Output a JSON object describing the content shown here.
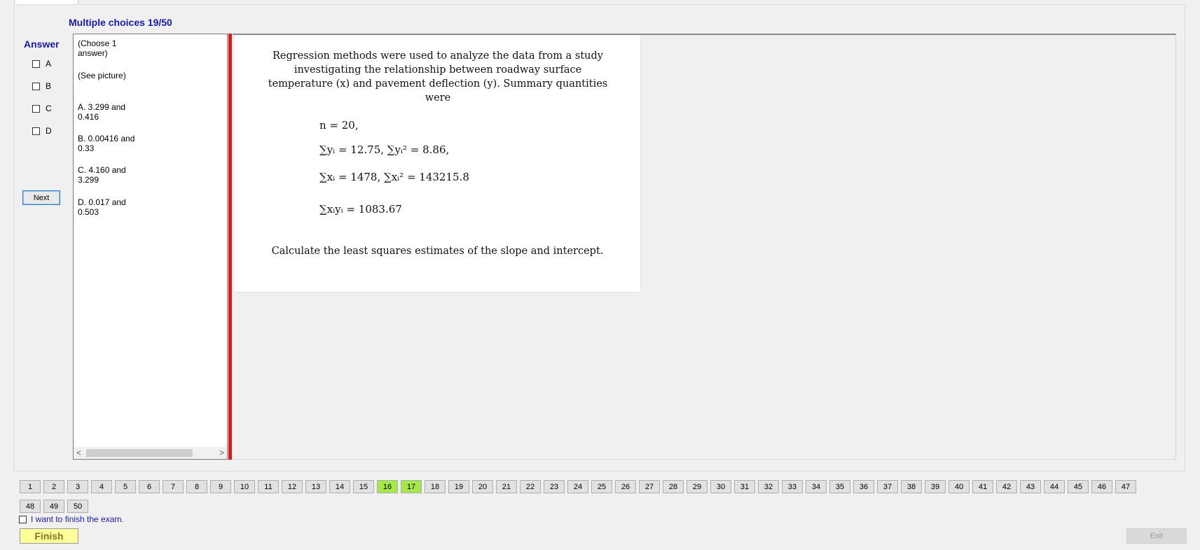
{
  "header": {
    "question_title": "Multiple choices 19/50"
  },
  "answer_panel": {
    "title": "Answer",
    "options": [
      "A",
      "B",
      "C",
      "D"
    ],
    "next_label": "Next"
  },
  "choices_text": {
    "instruction": "(Choose 1\nanswer)",
    "see_picture": "(See picture)",
    "items": [
      "A.  3.299 and\n0.416",
      "B.  0.00416 and\n0.33",
      "C.  4.160 and\n3.299",
      "D.  0.017 and\n0.503"
    ]
  },
  "picture": {
    "paragraph": "Regression methods were used to analyze the data from a study investigating the relationship between roadway surface temperature (x) and pavement deflection (y). Summary quantities were",
    "eq_n": "n = 20,",
    "eq_y": "∑yᵢ = 12.75,   ∑yᵢ² = 8.86,",
    "eq_x": "∑xᵢ = 1478,   ∑xᵢ² = 143215.8",
    "eq_xy": "∑xᵢyᵢ = 1083.67",
    "question": "Calculate the least squares estimates of the slope and intercept."
  },
  "navigation": {
    "row1": [
      "1",
      "2",
      "3",
      "4",
      "5",
      "6",
      "7",
      "8",
      "9",
      "10",
      "11",
      "12",
      "13",
      "14",
      "15",
      "16",
      "17",
      "18",
      "19",
      "20",
      "21",
      "22",
      "23",
      "24",
      "25",
      "26",
      "27",
      "28",
      "29",
      "30",
      "31",
      "32",
      "33",
      "34",
      "35",
      "36",
      "37",
      "38",
      "39",
      "40",
      "41",
      "42",
      "43",
      "44",
      "45",
      "46",
      "47"
    ],
    "row2": [
      "48",
      "49",
      "50"
    ],
    "answered": [
      "16",
      "17"
    ],
    "answered_color": "#a6e84a"
  },
  "footer": {
    "finish_check_label": "I want to finish the exam.",
    "finish_label": "Finish",
    "exit_label": "Exit"
  }
}
